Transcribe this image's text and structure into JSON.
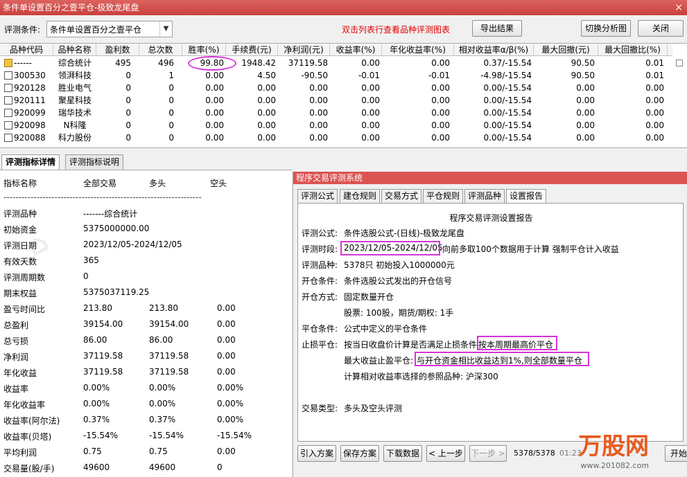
{
  "window": {
    "title": "条件单设置百分之壹平仓-极致龙尾盘",
    "close_icon": "×"
  },
  "toolbar": {
    "condition_label": "评测条件:",
    "condition_value": "条件单设置百分之壹平仓",
    "hint": "双击列表行查看品种评测图表",
    "export_label": "导出结果",
    "switch_label": "切换分析图",
    "close_label": "关闭"
  },
  "grid": {
    "headers": [
      "品种代码",
      "品种名称",
      "盈利数",
      "总次数",
      "胜率(%)",
      "手续费(元)",
      "净利润(元)",
      "收益率(%)",
      "年化收益率(%)",
      "相对收益率α/β(%)",
      "最大回撤(元)",
      "最大回撤比(%)"
    ],
    "rows": [
      [
        "------",
        "综合统计",
        "495",
        "496",
        "99.80",
        "1948.42",
        "37119.58",
        "0.00",
        "0.00",
        "0.37/-15.54",
        "90.50",
        "0.01"
      ],
      [
        "300530",
        "领湃科技",
        "0",
        "1",
        "0.00",
        "4.50",
        "-90.50",
        "-0.01",
        "-0.01",
        "-4.98/-15.54",
        "90.50",
        "0.01"
      ],
      [
        "920128",
        "胜业电气",
        "0",
        "0",
        "0.00",
        "0.00",
        "0.00",
        "0.00",
        "0.00",
        "0.00/-15.54",
        "0.00",
        "0.00"
      ],
      [
        "920111",
        "聚星科技",
        "0",
        "0",
        "0.00",
        "0.00",
        "0.00",
        "0.00",
        "0.00",
        "0.00/-15.54",
        "0.00",
        "0.00"
      ],
      [
        "920099",
        "瑞华技术",
        "0",
        "0",
        "0.00",
        "0.00",
        "0.00",
        "0.00",
        "0.00",
        "0.00/-15.54",
        "0.00",
        "0.00"
      ],
      [
        "920098",
        "N科隆",
        "0",
        "0",
        "0.00",
        "0.00",
        "0.00",
        "0.00",
        "0.00",
        "0.00/-15.54",
        "0.00",
        "0.00"
      ],
      [
        "920088",
        "科力股份",
        "0",
        "0",
        "0.00",
        "0.00",
        "0.00",
        "0.00",
        "0.00",
        "0.00/-15.54",
        "0.00",
        "0.00"
      ]
    ]
  },
  "left_tabs": [
    "评测指标详情",
    "评测指标说明"
  ],
  "left": {
    "headers": [
      "指标名称",
      "全部交易",
      "多头",
      "空头"
    ],
    "divider": "------------------------------------------------------------------",
    "rows": [
      [
        "评测品种",
        "-------综合统计",
        "",
        ""
      ],
      [
        "初始资金",
        "5375000000.00",
        "",
        ""
      ],
      [
        "评测日期",
        "2023/12/05-2024/12/05",
        "",
        ""
      ],
      [
        "有效天数",
        "365",
        "",
        ""
      ],
      [
        "评测周期数",
        "0",
        "",
        ""
      ],
      [
        "期末权益",
        "5375037119.25",
        "",
        ""
      ],
      [
        "盈亏时间比",
        "213.80",
        "213.80",
        "0.00"
      ],
      [
        "总盈利",
        "39154.00",
        "39154.00",
        "0.00"
      ],
      [
        "总亏损",
        "86.00",
        "86.00",
        "0.00"
      ],
      [
        "净利润",
        "37119.58",
        "37119.58",
        "0.00"
      ],
      [
        "年化收益",
        "37119.58",
        "37119.58",
        "0.00"
      ],
      [
        "收益率",
        "0.00%",
        "0.00%",
        "0.00%"
      ],
      [
        "年化收益率",
        "0.00%",
        "0.00%",
        "0.00%"
      ],
      [
        "收益率(阿尔法)",
        "0.37%",
        "0.37%",
        "0.00%"
      ],
      [
        "收益率(贝塔)",
        "-15.54%",
        "-15.54%",
        "-15.54%"
      ],
      [
        "平均利润",
        "0.75",
        "0.75",
        "0.00"
      ],
      [
        "交易量(股/手)",
        "49600",
        "49600",
        "0"
      ]
    ]
  },
  "right": {
    "title": "程序交易评测系统",
    "tabs": [
      "评测公式",
      "建仓规则",
      "交易方式",
      "平仓规则",
      "评测品种",
      "设置报告"
    ],
    "report_title": "程序交易评测设置报告",
    "lines": [
      {
        "label": "评测公式:",
        "value": "条件选股公式-(日线)-极致龙尾盘"
      },
      {
        "label": "评测时段:",
        "value": "2023/12/05-2024/12/05",
        "extra": "向前多取100个数据用于计算 强制平仓计入收益"
      },
      {
        "label": "评测品种:",
        "value": "5378只 初始投入1000000元"
      },
      {
        "label": "开仓条件:",
        "value": "条件选股公式发出的开仓信号"
      },
      {
        "label": "开仓方式:",
        "value": "固定数量开仓"
      },
      {
        "label": "",
        "value": "股票: 100股，期货/期权: 1手"
      },
      {
        "label": "平仓条件:",
        "value": "公式中定义的平仓条件"
      },
      {
        "label": "止损平仓:",
        "value": "按当日收盘价计算是否满足止损条件",
        "extra": "按本周期最高价平仓"
      },
      {
        "label": "",
        "value": "最大收益止盈平仓:",
        "extra": "与开仓资金相比收益达到1%,则全部数量平仓"
      },
      {
        "label": "",
        "value": "计算相对收益率选择的参照品种: 沪深300"
      },
      {
        "label": "交易类型:",
        "value": "多头及空头评测"
      }
    ],
    "buttons": [
      "引入方案",
      "保存方案",
      "下载数据",
      "< 上一步",
      "下一步 >"
    ],
    "progress": "5378/5378",
    "partial_text": "01:23",
    "start_label": "开始"
  },
  "logo": {
    "brand": "万股网",
    "url": "www.201082.com"
  }
}
